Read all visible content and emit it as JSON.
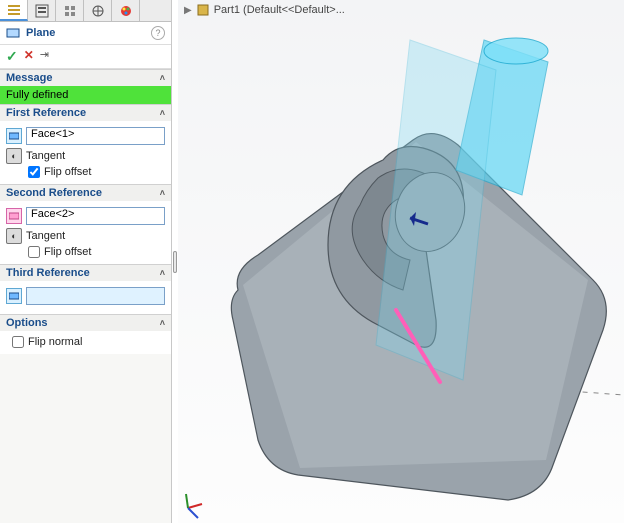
{
  "breadcrumb": {
    "part": "Part1 (Default<<Default>..."
  },
  "feature": {
    "title": "Plane"
  },
  "message": {
    "label": "Message",
    "status": "Fully defined"
  },
  "ref1": {
    "label": "First Reference",
    "value": "Face<1>",
    "type": "Tangent",
    "flip_label": "Flip offset",
    "flip_checked": true
  },
  "ref2": {
    "label": "Second Reference",
    "value": "Face<2>",
    "type": "Tangent",
    "flip_label": "Flip offset",
    "flip_checked": false
  },
  "ref3": {
    "label": "Third Reference",
    "value": ""
  },
  "options": {
    "label": "Options",
    "flip_normal_label": "Flip normal",
    "flip_normal_checked": false
  },
  "icons": {
    "toolbar_feature": "feature-manager-icon",
    "toolbar_property": "property-manager-icon",
    "toolbar_display": "display-manager-icon",
    "toolbar_config": "configuration-manager-icon",
    "toolbar_appear": "appearance-manager-icon",
    "plane": "plane-icon",
    "help": "help-icon",
    "ok": "ok-icon",
    "cancel": "cancel-icon",
    "pin": "pin-icon",
    "ref_face": "face-ref-icon",
    "tangent": "tangent-icon",
    "chevron": "chevron-up-icon",
    "part": "part-icon"
  },
  "colors": {
    "status_bg": "#4fe23a",
    "sel_blue": "#dff2ff",
    "sel_pink": "#ffd6ec",
    "accent": "#1a4d8a"
  }
}
